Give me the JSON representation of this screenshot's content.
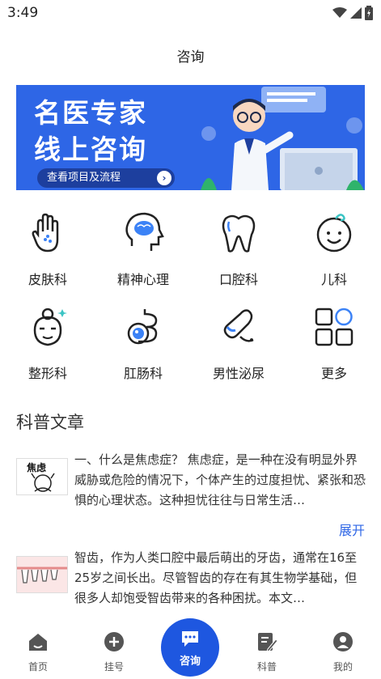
{
  "status": {
    "time": "3:49"
  },
  "page_title": "咨询",
  "banner": {
    "line1": "名医专家",
    "line2": "线上咨询",
    "button_label": "查看项目及流程",
    "arrow": "›"
  },
  "categories": [
    {
      "label": "皮肤科",
      "icon": "hand-icon"
    },
    {
      "label": "精神心理",
      "icon": "brain-head-icon"
    },
    {
      "label": "口腔科",
      "icon": "tooth-icon"
    },
    {
      "label": "儿科",
      "icon": "baby-face-icon"
    },
    {
      "label": "整形科",
      "icon": "face-beauty-icon"
    },
    {
      "label": "肛肠科",
      "icon": "intestine-icon"
    },
    {
      "label": "男性泌尿",
      "icon": "male-urology-icon"
    },
    {
      "label": "更多",
      "icon": "grid-more-icon"
    }
  ],
  "section_title": "科普文章",
  "articles": [
    {
      "text": "一、什么是焦虑症？ 焦虑症，是一种在没有明显外界威胁或危险的情况下，个体产生的过度担忧、紧张和恐惧的心理状态。这种担忧往往与日常生活…",
      "thumb_text": "焦虑"
    },
    {
      "text": "智齿，作为人类口腔中最后萌出的牙齿，通常在16至25岁之间长出。尽管智齿的存在有其生物学基础，但很多人却饱受智齿带来的各种困扰。本文…"
    }
  ],
  "expand_label": "展开",
  "tabs": {
    "home": "首页",
    "register": "挂号",
    "consult": "咨询",
    "science": "科普",
    "mine": "我的"
  },
  "colors": {
    "accent": "#1e57e0",
    "banner": "#2e66e6"
  }
}
